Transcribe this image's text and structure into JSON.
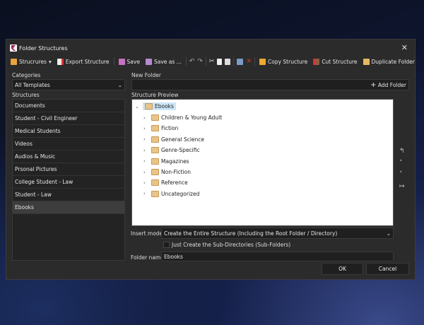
{
  "window": {
    "title": "Folder Structures",
    "close": "✕"
  },
  "toolbar": {
    "structures": "Strucrures",
    "export": "Export Structure",
    "save": "Save",
    "save_as": "Save as ...",
    "copy": "Copy Structure",
    "cut": "Cut Structure",
    "duplicate": "Duplicate Folder"
  },
  "left": {
    "categories_label": "Categories",
    "category_value": "All Templates",
    "structures_label": "Structures",
    "items": [
      "Documents",
      "Student - Civil Engineer",
      "Medical Students",
      "Videos",
      "Audios & Music",
      "Prsonal Pictures",
      "College Student - Law",
      "Student - Law",
      "Ebooks"
    ],
    "selected": "Ebooks"
  },
  "right": {
    "new_folder_label": "New Folder",
    "new_folder_value": "",
    "add_folder": "Add Folder",
    "preview_label": "Structure Preview",
    "root": "Ebooks",
    "children": [
      "Children & Young Adult",
      "Fiction",
      "General Science",
      "Genre-Specific",
      "Magazines",
      "Non-Fiction",
      "Reference",
      "Uncategorized"
    ]
  },
  "bottom": {
    "insert_mode_label": "Insert mode:",
    "insert_mode_value": "Create the Entire Structure (Including the Root Folder / Directory)",
    "checkbox_label": "Just Create the Sub-Directories (Sub-Folders)",
    "checkbox_checked": false,
    "folder_name_label": "Folder name:",
    "folder_name_value": "Ebooks",
    "ok": "OK",
    "cancel": "Cancel"
  }
}
